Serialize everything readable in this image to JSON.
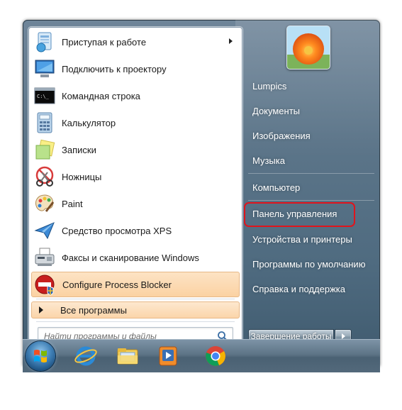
{
  "programs": [
    {
      "label": "Приступая к работе",
      "icon": "getting-started-icon",
      "has_submenu": true
    },
    {
      "label": "Подключить к проектору",
      "icon": "projector-icon"
    },
    {
      "label": "Командная строка",
      "icon": "cmd-icon"
    },
    {
      "label": "Калькулятор",
      "icon": "calculator-icon"
    },
    {
      "label": "Записки",
      "icon": "sticky-notes-icon"
    },
    {
      "label": "Ножницы",
      "icon": "scissors-icon"
    },
    {
      "label": "Paint",
      "icon": "paint-palette-icon"
    },
    {
      "label": "Средство просмотра XPS",
      "icon": "xps-viewer-icon"
    },
    {
      "label": "Факсы и сканирование Windows",
      "icon": "fax-scan-icon"
    },
    {
      "label": "Configure Process Blocker",
      "icon": "process-blocker-icon",
      "highlighted": true
    }
  ],
  "all_programs_label": "Все программы",
  "search": {
    "placeholder": "Найти программы и файлы"
  },
  "right_pane": {
    "user": "Lumpics",
    "items": [
      "Документы",
      "Изображения",
      "Музыка",
      "Компьютер",
      "Панель управления",
      "Устройства и принтеры",
      "Программы по умолчанию",
      "Справка и поддержка"
    ],
    "highlighted_item": "Панель управления"
  },
  "shutdown_label": "Завершение работы",
  "taskbar_icons": [
    "start-orb-icon",
    "internet-explorer-icon",
    "explorer-folder-icon",
    "media-player-icon",
    "chrome-icon"
  ],
  "colors": {
    "highlight_box": "#e0141c",
    "menu_hover": "#fbd2a3"
  }
}
